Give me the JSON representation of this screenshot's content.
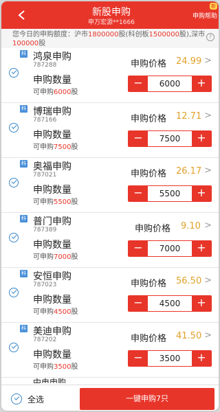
{
  "header": {
    "title": "新股申购",
    "subtitle": "申万宏源**1666",
    "help_label": "申购帮助",
    "help_badge": "新"
  },
  "info": {
    "prefix": "您今日的申购额度：沪市",
    "sh_amount": "1800000",
    "mid": "股(科创板",
    "star_amount": "1500000",
    "mid2": "股),深市",
    "sz_amount": "100000",
    "suffix": "股"
  },
  "common": {
    "market_tag": "科",
    "price_label": "申购价格",
    "qty_label": "申购数量",
    "avail_prefix": "可申购",
    "avail_suffix": "股",
    "minus": "−",
    "plus": "+",
    "chevron": ">"
  },
  "items": [
    {
      "name": "鸿泉申购",
      "code": "787288",
      "price": "24.99",
      "qty": "6000",
      "avail": "6000"
    },
    {
      "name": "博瑞申购",
      "code": "787166",
      "price": "12.71",
      "qty": "7500",
      "avail": "7500"
    },
    {
      "name": "奥福申购",
      "code": "787021",
      "price": "26.17",
      "qty": "5500",
      "avail": "5500"
    },
    {
      "name": "普门申购",
      "code": "787389",
      "price": "9.10",
      "qty": "7000",
      "avail": "7000"
    },
    {
      "name": "安恒申购",
      "code": "787023",
      "price": "56.50",
      "qty": "4500",
      "avail": "4500"
    },
    {
      "name": "美迪申购",
      "code": "787202",
      "price": "41.50",
      "qty": "3500",
      "avail": "3500"
    }
  ],
  "partial_item": {
    "name": "中电申购"
  },
  "footer": {
    "select_all_label": "全选",
    "submit_label": "一键申购7只"
  }
}
